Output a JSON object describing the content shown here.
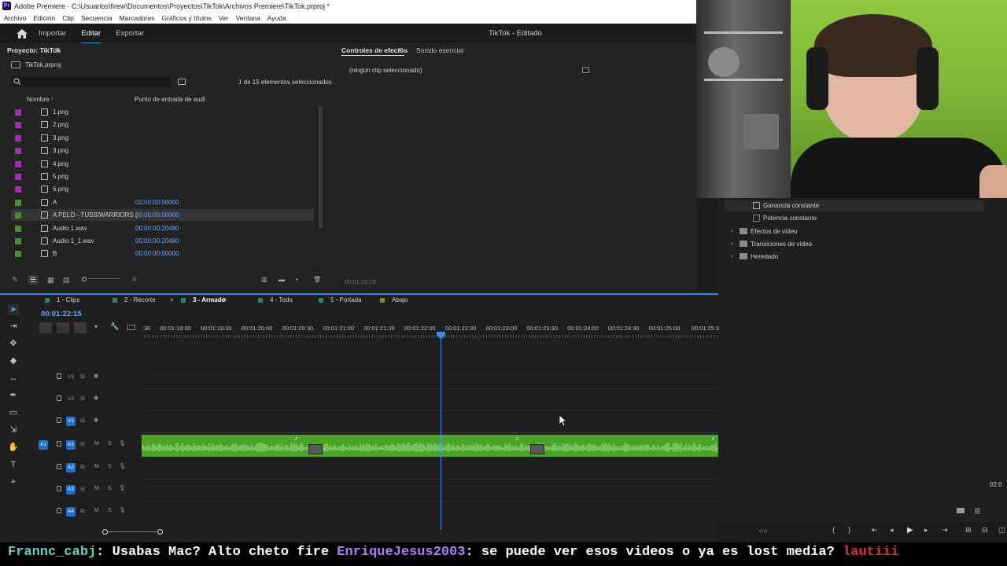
{
  "window": {
    "title": "Adobe Premiere - C:\\Usuarios\\firew\\Documentos\\Proyectos\\TikTok\\Archivos Premiere\\TikTok.prproj *",
    "app_icon_text": "Pr"
  },
  "menu": [
    "Archivo",
    "Edición",
    "Clip",
    "Secuencia",
    "Marcadores",
    "Gráficos y títulos",
    "Ver",
    "Ventana",
    "Ayuda"
  ],
  "appbar": {
    "tabs": [
      "Importar",
      "Editar",
      "Exportar"
    ],
    "active_tab": "Editar",
    "document_title": "TikTok - Editado"
  },
  "project": {
    "tab_label": "Proyecto: TikTok",
    "file_name": "TikTok.prproj",
    "search_placeholder": "",
    "selection_status": "1 de 15 elementos seleccionados",
    "col_name": "Nombre",
    "col_in_point": "Punto de entrada de audi",
    "items": [
      {
        "name": "1.png",
        "timecode": "",
        "color": "#9b2fae",
        "icon": "image-icon"
      },
      {
        "name": "2.png",
        "timecode": "",
        "color": "#9b2fae",
        "icon": "image-icon"
      },
      {
        "name": "3.png",
        "timecode": "",
        "color": "#9b2fae",
        "icon": "image-icon"
      },
      {
        "name": "3.png",
        "timecode": "",
        "color": "#9b2fae",
        "icon": "image-icon"
      },
      {
        "name": "4.png",
        "timecode": "",
        "color": "#9b2fae",
        "icon": "image-icon"
      },
      {
        "name": "5.png",
        "timecode": "",
        "color": "#9b2fae",
        "icon": "image-icon"
      },
      {
        "name": "6.png",
        "timecode": "",
        "color": "#9b2fae",
        "icon": "image-icon"
      },
      {
        "name": "A",
        "timecode": "00:00:00:00000",
        "color": "#4c8c2b",
        "icon": "sequence-icon"
      },
      {
        "name": "A PELO - TUSSIWARRIORS (",
        "timecode": "00:00:00:00000",
        "color": "#4c8c2b",
        "icon": "audio-clip-icon"
      },
      {
        "name": "Audio 1.wav",
        "timecode": "00:00:00:20480",
        "color": "#4c8c2b",
        "icon": "audio-clip-icon"
      },
      {
        "name": "Audio 1_1.wav",
        "timecode": "00:00:00:20480",
        "color": "#4c8c2b",
        "icon": "audio-clip-icon"
      },
      {
        "name": "B",
        "timecode": "00:00:00:00000",
        "color": "#4c8c2b",
        "icon": "sequence-icon"
      }
    ],
    "selected_index": 8
  },
  "effects": {
    "tabs": [
      "Controles de efectos",
      "Sonido esencial"
    ],
    "active_tab": "Controles de efectos",
    "empty_message": "(ningún clip seleccionado)",
    "timecode": "00:01:22:15"
  },
  "effects_browser": {
    "items": [
      {
        "label": "Ganancia constante",
        "type": "preset",
        "expandable": false
      },
      {
        "label": "Potencia constante",
        "type": "preset",
        "expandable": false
      },
      {
        "label": "Efectos de vídeo",
        "type": "folder",
        "expandable": true
      },
      {
        "label": "Transiciones de vídeo",
        "type": "folder",
        "expandable": true
      },
      {
        "label": "Heredado",
        "type": "folder",
        "expandable": true
      }
    ],
    "side_timecode": "02:0"
  },
  "timeline": {
    "sequence_tabs": [
      "1 - Clips",
      "2 - Recorte",
      "3 - Armado",
      "4 - Todo",
      "5 - Portada",
      "Abajo"
    ],
    "tab_colors": [
      "#2d8a55",
      "#2d8a55",
      "#2d8a55",
      "#2d8a55",
      "#2d8a55",
      "#7b8a2d"
    ],
    "active_tab": "3 - Armado",
    "current_timecode": "00:01:22:15",
    "ruler_labels": [
      ":30",
      "00:01:19:00",
      "00:01:19:30",
      "00:01:20:00",
      "00:01:20:30",
      "00:01:21:00",
      "00:01:21:30",
      "00:01:22:00",
      "00:01:22:30",
      "00:01:23:00",
      "00:01:23:30",
      "00:01:24:00",
      "00:01:24:30",
      "00:01:25:00",
      "00:01:25:3"
    ],
    "video_tracks": [
      "V3",
      "V2",
      "V1"
    ],
    "audio_tracks": [
      "A1",
      "A2",
      "A3",
      "A4"
    ],
    "source_patch": "A1",
    "track_letters": {
      "mute": "M",
      "solo": "S"
    }
  },
  "chat": {
    "messages": [
      {
        "user": "Frannc_cabj",
        "user_color": "#5fd3c8",
        "text": "Usabas Mac? Alto cheto fire"
      },
      {
        "user": "EnriqueJesus2003",
        "user_color": "#b57bff",
        "text": "se puede ver esos videos o ya es lost media?"
      },
      {
        "user": "lautiii",
        "user_color": "#e0303a",
        "text": ""
      }
    ]
  }
}
